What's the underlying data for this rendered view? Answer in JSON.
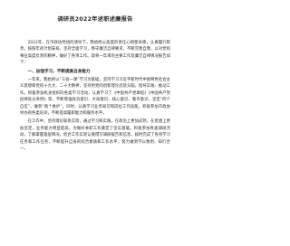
{
  "document": {
    "title": "调研员2022年述职述廉报告",
    "intro": "2022年，在市政协党组的领导下，我始终以高度的责任心和使命感，认真履行职责，按照年初计划安排，坚持全面学习，恪守廉洁自律要求，不断完善自我，以对党的事业高度负责的精神，做好了各项工作。现将一年来的主要工作及廉洁自律情况报告如下：",
    "section1_heading": "一、加强学习，不断提高自身能力",
    "section1_para1": "一年来，我始终以“三会一课”学习为基础，坚持学习习近平新时代中国特色社会主义思想和党的十九大、二十大精神，坚持用党的创新理论武装头脑，指导实践、推动工作。积极参加机关组织的各类学习活动，认真学习了《中国共产党章程》《中国共产党纪律处分条例》等，不断增强政治意识、大局意识、核心意识、看齐意识，坚定“四个自信”，做到“两个维护”。同时，认真学习业务知识和岗位工作技能，积极参加市政协举办的各类培训，不断提高履职能力和服务水平。",
    "section1_para2": "在工作中，坚持理论联系实际，通过学习和实践，在政治上更加成熟，在思想上更加坚定，业务能力明显提高，为做好本职工作奠定了坚实基础。积极参加各类调研活动，了解掌握基层情况，结合工作实际认真撰写调研报告和信息，按时完成了各项学习任务和工作任务，不断提升自身的综合素质和工作水平，努力做到学以致用、知行合一。"
  }
}
